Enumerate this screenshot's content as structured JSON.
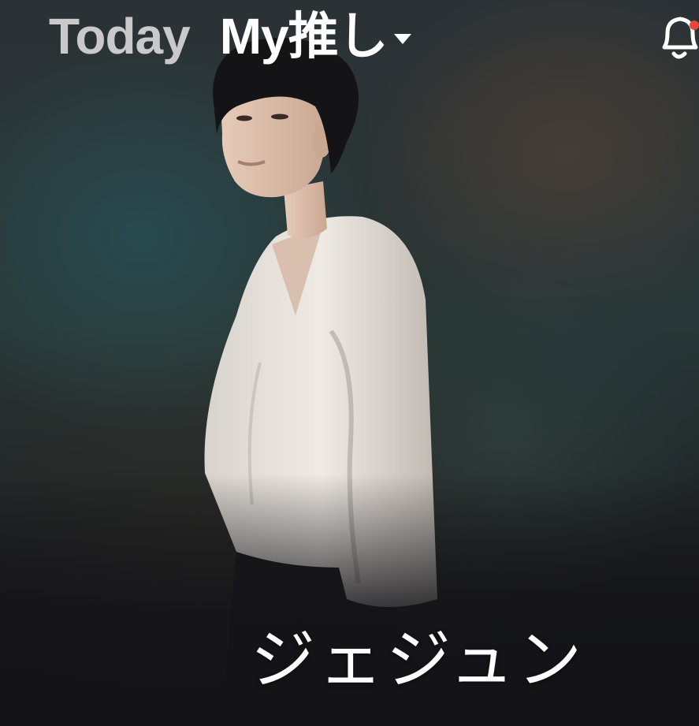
{
  "top_nav": {
    "tabs": [
      {
        "label": "Today",
        "active": false
      },
      {
        "label": "My推し",
        "active": true
      }
    ]
  },
  "icons": {
    "dropdown": "caret-down-icon",
    "notification": "bell-icon"
  },
  "notification": {
    "has_unread": true
  },
  "feature": {
    "artist_name": "ジェジュン"
  },
  "colors": {
    "active_tab": "#ffffff",
    "inactive_tab": "#c9c9c9",
    "badge": "#e5483a"
  }
}
